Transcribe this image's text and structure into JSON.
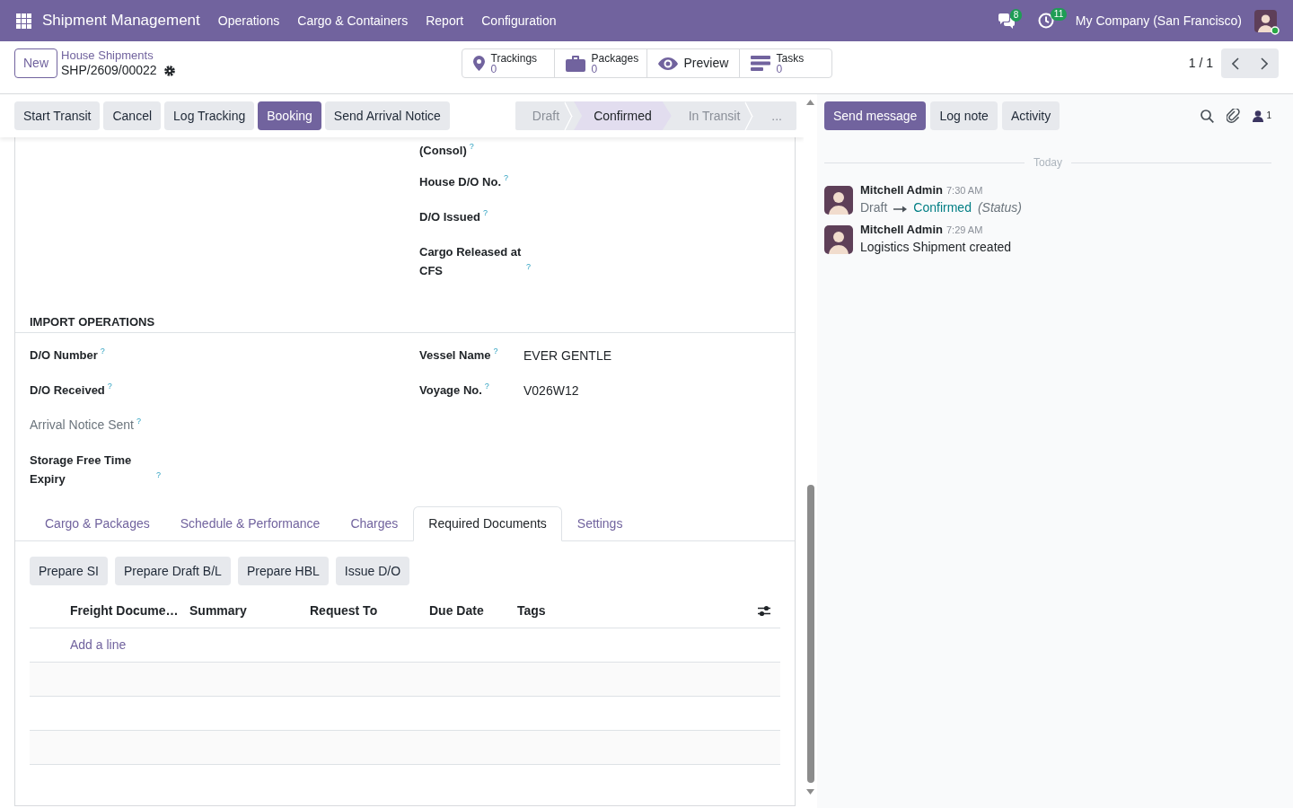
{
  "navbar": {
    "app_name": "Shipment Management",
    "menus": [
      "Operations",
      "Cargo & Containers",
      "Report",
      "Configuration"
    ],
    "message_count": "8",
    "activity_count": "11",
    "company": "My Company (San Francisco)",
    "user": {
      "online": true
    }
  },
  "control_panel": {
    "new_button": "New",
    "breadcrumb": "House Shipments",
    "record_name": "SHP/2609/00022",
    "smart_buttons": [
      {
        "kind": "tracking",
        "label": "Trackings",
        "value": "0"
      },
      {
        "kind": "package",
        "label": "Packages",
        "value": "0"
      },
      {
        "kind": "preview",
        "label": "Preview"
      },
      {
        "kind": "task",
        "label": "Tasks",
        "value": "0"
      }
    ],
    "pager": "1 / 1"
  },
  "action_buttons": [
    {
      "label": "Start Transit",
      "primary": false
    },
    {
      "label": "Cancel",
      "primary": false
    },
    {
      "label": "Log Tracking",
      "primary": false
    },
    {
      "label": "Booking",
      "primary": true
    },
    {
      "label": "Send Arrival Notice",
      "primary": false
    }
  ],
  "statusbar": [
    {
      "label": "Draft",
      "selected": false
    },
    {
      "label": "Confirmed",
      "selected": true
    },
    {
      "label": "In Transit",
      "selected": false
    },
    {
      "label": "...",
      "selected": false
    }
  ],
  "form": {
    "top_fields": [
      {
        "label": "(Consol)",
        "help": "?",
        "readonly": false
      },
      {
        "label": "House D/O No.",
        "help": "?",
        "readonly": false
      },
      {
        "label": "D/O Issued",
        "help": "?",
        "readonly": false
      },
      {
        "label": "Cargo Released at CFS",
        "help": "?",
        "readonly": false
      }
    ],
    "section_title": "IMPORT OPERATIONS",
    "import_fields_left": [
      {
        "label": "D/O Number",
        "help": "?",
        "readonly": false
      },
      {
        "label": "D/O Received",
        "help": "?",
        "readonly": false
      },
      {
        "label": "Arrival Notice Sent",
        "help": "?",
        "readonly": true
      },
      {
        "label": "Storage Free Time Expiry",
        "help": "?",
        "readonly": false
      }
    ],
    "import_fields_right": [
      {
        "label": "Vessel Name",
        "help": "?",
        "readonly": false,
        "value": "EVER GENTLE"
      },
      {
        "label": "Voyage No.",
        "help": "?",
        "readonly": false,
        "value": "V026W12"
      }
    ],
    "tabs": [
      {
        "label": "Cargo & Packages",
        "selected": false
      },
      {
        "label": "Schedule & Performance",
        "selected": false
      },
      {
        "label": "Charges",
        "selected": false
      },
      {
        "label": "Required Documents",
        "selected": true
      },
      {
        "label": "Settings",
        "selected": false
      }
    ],
    "document_buttons": [
      "Prepare SI",
      "Prepare Draft B/L",
      "Prepare HBL",
      "Issue D/O"
    ],
    "table": {
      "columns": [
        "Freight Docume…",
        "Summary",
        "Request To",
        "Due Date",
        "Tags"
      ],
      "add_line": "Add a line"
    }
  },
  "chatter": {
    "buttons": [
      {
        "label": "Send message",
        "primary": true
      },
      {
        "label": "Log note",
        "primary": false
      },
      {
        "label": "Activity",
        "primary": false
      }
    ],
    "followers_count": "1",
    "date_separator": "Today",
    "messages": [
      {
        "kind": "tracking",
        "author": "Mitchell Admin",
        "time": "7:30 AM",
        "old_value": "Draft",
        "new_value": "Confirmed",
        "field": "(Status)"
      },
      {
        "kind": "text",
        "author": "Mitchell Admin",
        "time": "7:29 AM",
        "body": "Logistics Shipment created"
      }
    ]
  }
}
